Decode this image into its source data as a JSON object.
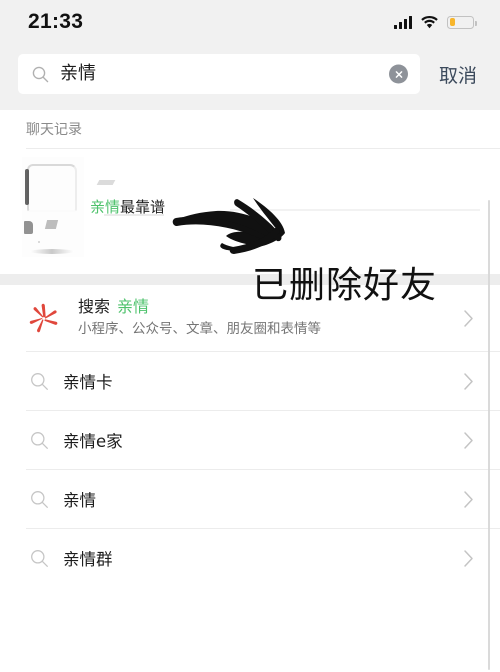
{
  "status_bar": {
    "time": "21:33",
    "cell_icon": "cellular-signal-icon",
    "wifi_icon": "wifi-icon",
    "battery_icon": "battery-low-icon",
    "battery_percent": 22,
    "battery_color": "#f7b52c"
  },
  "search": {
    "value": "亲情",
    "placeholder": "搜索",
    "mag_icon": "search-icon",
    "clear_icon": "clear-circle-icon",
    "cancel_label": "取消",
    "cancel_color": "#3c4a5c"
  },
  "results": {
    "chat_section": {
      "label": "聊天记录",
      "row": {
        "title_highlight": "亲情",
        "title_rest": "最靠谱",
        "highlight_color": "#4ec26c",
        "avatar_icon": "chat-thumbnail-image"
      }
    },
    "wechat_search": {
      "icon": "wechat-search-starburst-icon",
      "icon_color": "#e0473c",
      "title": "搜索",
      "keyword": "亲情",
      "subtitle": "小程序、公众号、文章、朋友圈和表情等",
      "chevron_icon": "chevron-right-icon"
    },
    "suggestions": [
      {
        "label": "亲情卡",
        "mag_icon": "search-icon",
        "chevron_icon": "chevron-right-icon"
      },
      {
        "label": "亲情e家",
        "mag_icon": "search-icon",
        "chevron_icon": "chevron-right-icon"
      },
      {
        "label": "亲情",
        "mag_icon": "search-icon",
        "chevron_icon": "chevron-right-icon"
      },
      {
        "label": "亲情群",
        "mag_icon": "search-icon",
        "chevron_icon": "chevron-right-icon"
      }
    ]
  },
  "annotation": {
    "arrow_icon": "hand-drawn-right-arrow",
    "note": "已删除好友",
    "color": "#111111"
  }
}
